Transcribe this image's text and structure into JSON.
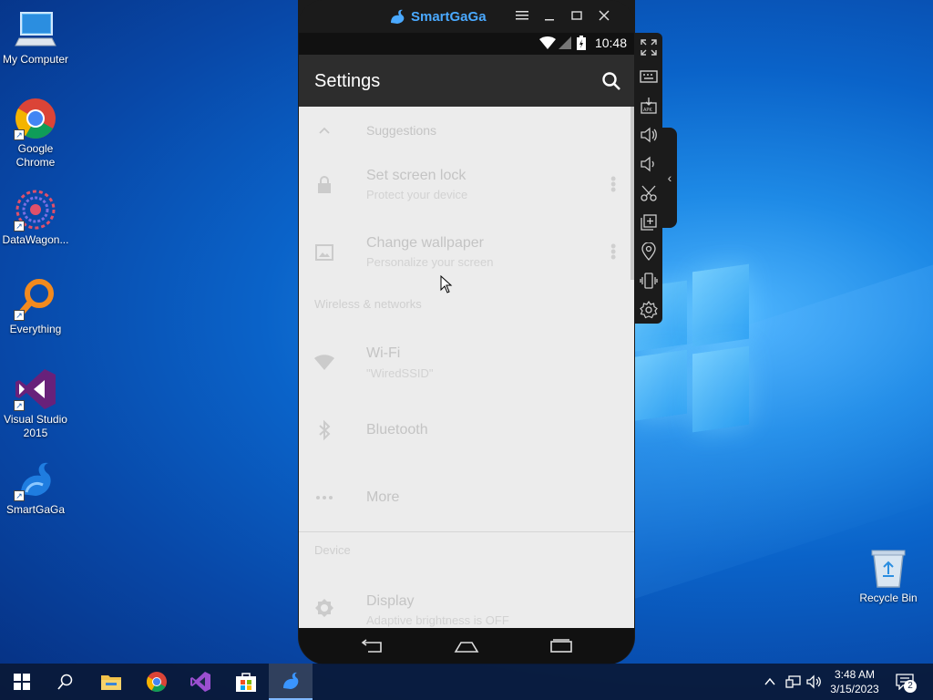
{
  "desktop": {
    "icons": [
      {
        "label": "My Computer",
        "icon": "computer-icon"
      },
      {
        "label": "Google Chrome",
        "icon": "chrome-icon"
      },
      {
        "label": "DataWagon...",
        "icon": "datawagon-icon"
      },
      {
        "label": "Everything",
        "icon": "everything-search-icon"
      },
      {
        "label": "Visual Studio 2015",
        "icon": "visual-studio-icon"
      },
      {
        "label": "SmartGaGa",
        "icon": "smartgaga-icon"
      }
    ],
    "recycle_bin": {
      "label": "Recycle Bin",
      "icon": "recycle-bin-icon"
    }
  },
  "emulator": {
    "brand": "SmartGaGa",
    "title_buttons": [
      "menu-icon",
      "minimize-icon",
      "maximize-icon",
      "close-icon"
    ],
    "status_time": "10:48",
    "toolbar_title": "Settings",
    "settings": {
      "suggestions_header": "Suggestions",
      "suggestions": [
        {
          "title": "Set screen lock",
          "subtitle": "Protect your device",
          "icon": "lock-icon"
        },
        {
          "title": "Change wallpaper",
          "subtitle": "Personalize your screen",
          "icon": "wallpaper-icon"
        }
      ],
      "wireless_header": "Wireless & networks",
      "wireless": [
        {
          "title": "Wi-Fi",
          "subtitle": "\"WiredSSID\"",
          "icon": "wifi-icon"
        },
        {
          "title": "Bluetooth",
          "icon": "bluetooth-icon"
        },
        {
          "title": "More",
          "icon": "more-horizontal-icon"
        }
      ],
      "device_header": "Device",
      "device": [
        {
          "title": "Display",
          "subtitle": "Adaptive brightness is OFF",
          "icon": "display-brightness-icon"
        }
      ]
    },
    "side_tools": [
      "fullscreen-icon",
      "keyboard-icon",
      "apk-install-icon",
      "volume-up-icon",
      "volume-down-icon",
      "screenshot-scissors-icon",
      "multi-instance-icon",
      "location-icon",
      "shake-icon",
      "settings-gear-icon"
    ]
  },
  "taskbar": {
    "items": [
      "windows-start-icon",
      "search-icon",
      "file-explorer-icon",
      "chrome-icon",
      "visual-studio-icon",
      "microsoft-store-icon",
      "smartgaga-icon"
    ],
    "clock_time": "3:48 AM",
    "clock_date": "3/15/2023",
    "notification_count": "2"
  }
}
